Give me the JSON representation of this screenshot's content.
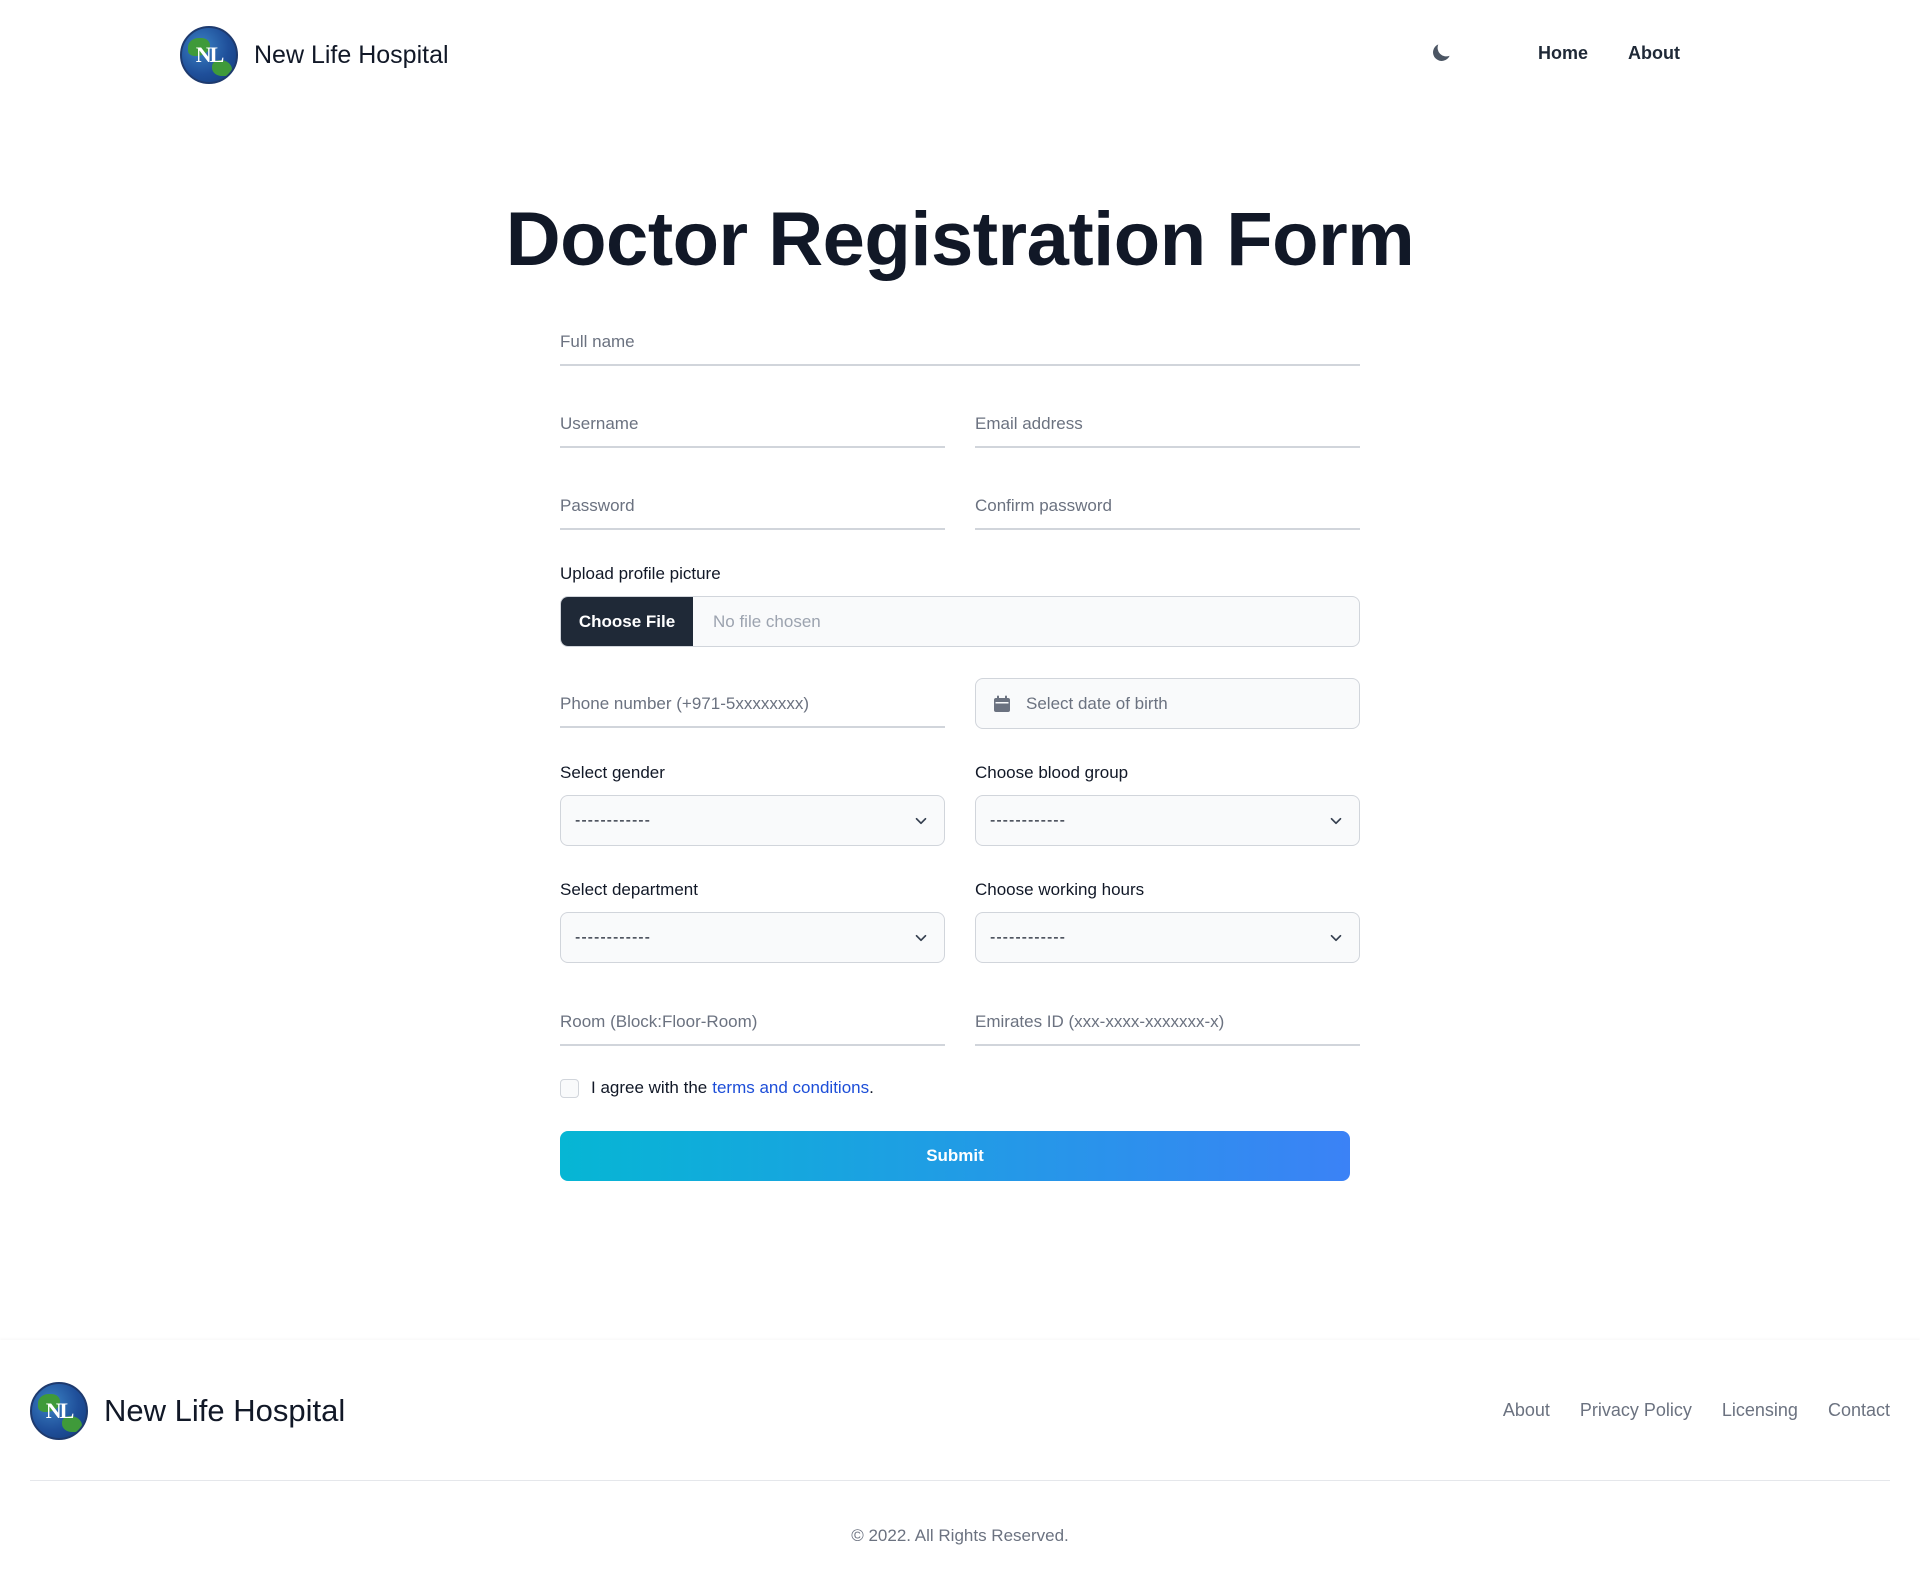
{
  "nav": {
    "brand": "New Life Hospital",
    "logo_text": "NL",
    "links": [
      "Home",
      "About"
    ],
    "theme_toggle_icon": "moon-icon"
  },
  "page": {
    "title": "Doctor Registration Form"
  },
  "form": {
    "full_name_placeholder": "Full name",
    "username_placeholder": "Username",
    "email_placeholder": "Email address",
    "password_placeholder": "Password",
    "confirm_password_placeholder": "Confirm password",
    "upload_label": "Upload profile picture",
    "file_button": "Choose File",
    "file_status": "No file chosen",
    "phone_placeholder": "Phone number (+971-5xxxxxxxx)",
    "dob_placeholder": "Select date of birth",
    "gender_label": "Select gender",
    "gender_value": "------------",
    "blood_label": "Choose blood group",
    "blood_value": "------------",
    "department_label": "Select department",
    "department_value": "------------",
    "hours_label": "Choose working hours",
    "hours_value": "------------",
    "room_placeholder": "Room (Block:Floor-Room)",
    "emirates_placeholder": "Emirates ID (xxx-xxxx-xxxxxxx-x)",
    "agree_text": "I agree with the",
    "agree_link": "terms and conditions",
    "agree_suffix": ".",
    "submit_label": "Submit",
    "agree_checked": false
  },
  "footer": {
    "brand": "New Life Hospital",
    "logo_text": "NL",
    "links": [
      "About",
      "Privacy Policy",
      "Licensing",
      "Contact"
    ],
    "copyright": "© 2022. All Rights Reserved."
  },
  "colors": {
    "submit_gradient_start": "#06b6d4",
    "submit_gradient_end": "#3b82f6",
    "link": "#1d4ed8",
    "file_button_bg": "#1f2937"
  }
}
